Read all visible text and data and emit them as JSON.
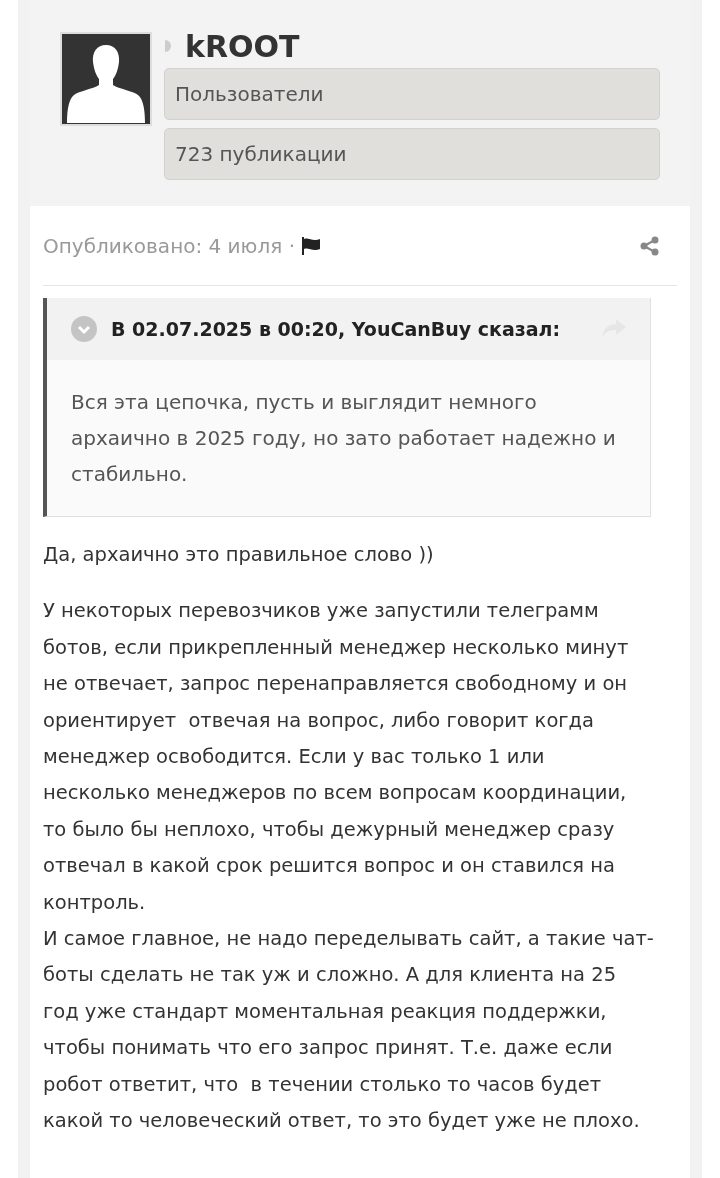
{
  "author": {
    "name": "kROOT",
    "group": "Пользователи",
    "posts": "723 публикации"
  },
  "post": {
    "published": "Опубликовано: 4 июля ·",
    "quote": {
      "header": "В 02.07.2025 в 00:20, YouCanBuy сказал:",
      "text": "Вся эта цепочка, пусть и выглядит немного архаично в 2025 году, но зато работает надежно и стабильно."
    },
    "paragraphs": [
      [
        "Да, архаично это правильное слово ))"
      ],
      [
        "У некоторых перевозчиков уже запустили телеграмм ботов, если прикрепленный менеджер несколько минут не отвечает, запрос перенаправляется свободному и он ориентирует  отвечая на вопрос, либо говорит когда менеджер освободится. Если у вас только 1 или несколько менеджеров по всем вопросам координации, то было бы неплохо, чтобы дежурный менеджер сразу отвечал в какой срок решится вопрос и он ставился на контроль.",
        "И самое главное, не надо переделывать сайт, а такие чат-боты сделать не так уж и сложно. А для клиента на 25 год уже стандарт моментальная реакция поддержки, чтобы понимать что его запрос принят. Т.е. даже если робот ответит, что  в течении столько то часов будет какой то человеческий ответ, то это будет уже не плохо."
      ]
    ]
  }
}
